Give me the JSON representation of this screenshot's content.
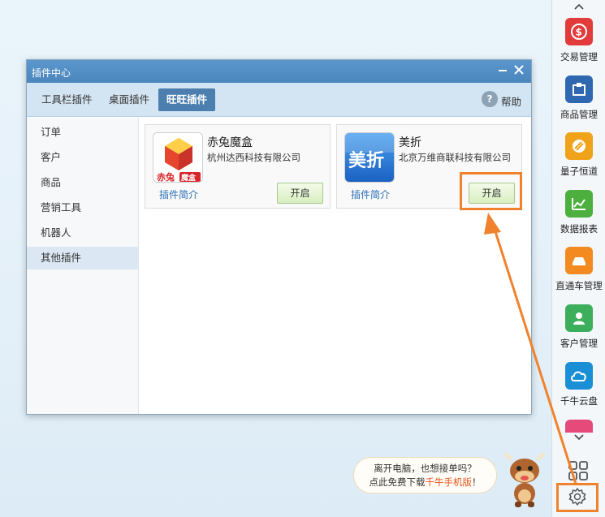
{
  "dock": {
    "items": [
      {
        "label": "交易管理",
        "icon": "trade-icon",
        "color": "#e23b3b"
      },
      {
        "label": "商品管理",
        "icon": "goods-icon",
        "color": "#2f67b1"
      },
      {
        "label": "量子恒道",
        "icon": "quantum-icon",
        "color": "#f0a21a"
      },
      {
        "label": "数据报表",
        "icon": "chart-report-icon",
        "color": "#4caf3e"
      },
      {
        "label": "直通车管理",
        "icon": "car-icon",
        "color": "#f38a1f"
      },
      {
        "label": "客户管理",
        "icon": "customer-icon",
        "color": "#3cae5c"
      },
      {
        "label": "千牛云盘",
        "icon": "cloud-icon",
        "color": "#1b8fd6"
      }
    ]
  },
  "window": {
    "title": "插件中心",
    "tabs": [
      "工具栏插件",
      "桌面插件",
      "旺旺插件"
    ],
    "active_tab": 2,
    "help_label": "帮助",
    "sidebar": [
      "订单",
      "客户",
      "商品",
      "营销工具",
      "机器人",
      "其他插件"
    ],
    "active_sidebar": 5,
    "plugins": [
      {
        "name": "赤兔魔盒",
        "company": "杭州达西科技有限公司",
        "intro": "插件简介",
        "button": "开启",
        "logo_text": "赤兔",
        "logo_badge": "魔盒"
      },
      {
        "name": "美折",
        "company": "北京万维商联科技有限公司",
        "intro": "插件简介",
        "button": "开启",
        "logo_text": "美折"
      }
    ]
  },
  "promo": {
    "line1": "离开电脑，也想接单吗？",
    "line2_prefix": "点此免费下载",
    "line2_highlight": "千牛手机版",
    "line2_suffix": "！"
  },
  "accent": "#f0822d"
}
